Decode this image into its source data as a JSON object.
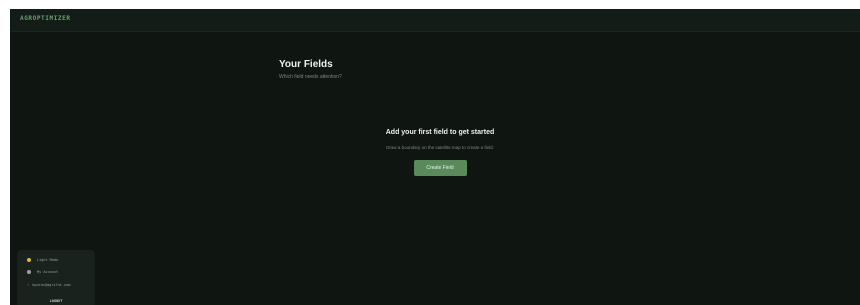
{
  "app": {
    "brand": "AGROPTIMIZER"
  },
  "page": {
    "title": "Your Fields",
    "subtitle": "Which field needs attention?"
  },
  "empty_state": {
    "title": "Add your first field to get started",
    "description": "Draw a boundary on the satellite map to create a field.",
    "button_label": "Create Field"
  },
  "sidebar": {
    "theme_toggle_label": "Light Mode",
    "account_label": "My Account",
    "user_email": "bpuros@agrifut.com",
    "logout_label": "LOGOUT"
  },
  "colors": {
    "accent": "#5a8a5c",
    "background": "#0f1612",
    "theme_icon": "#e0b33a"
  }
}
